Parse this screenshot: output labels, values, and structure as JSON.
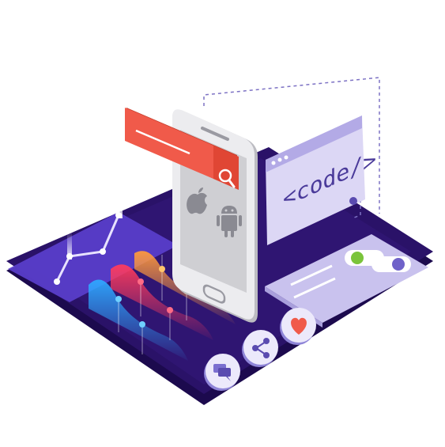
{
  "code_window": {
    "text": "<code/>"
  },
  "colors": {
    "platform_dark": "#2a1268",
    "platform_edge": "#1c0a4e",
    "accent_red": "#f05a4a",
    "lavender": "#c9c2ee",
    "phone_body": "#e4e4e6",
    "phone_screen": "#cfcfd3"
  },
  "icons": {
    "search": "search-icon",
    "apple": "apple-logo-icon",
    "android": "android-logo-icon",
    "chat": "chat-icon",
    "share": "share-icon",
    "heart": "heart-icon"
  },
  "toggles": [
    {
      "state": "on",
      "color": "#7ac43a"
    },
    {
      "state": "off",
      "color": "#6f62c9"
    }
  ]
}
